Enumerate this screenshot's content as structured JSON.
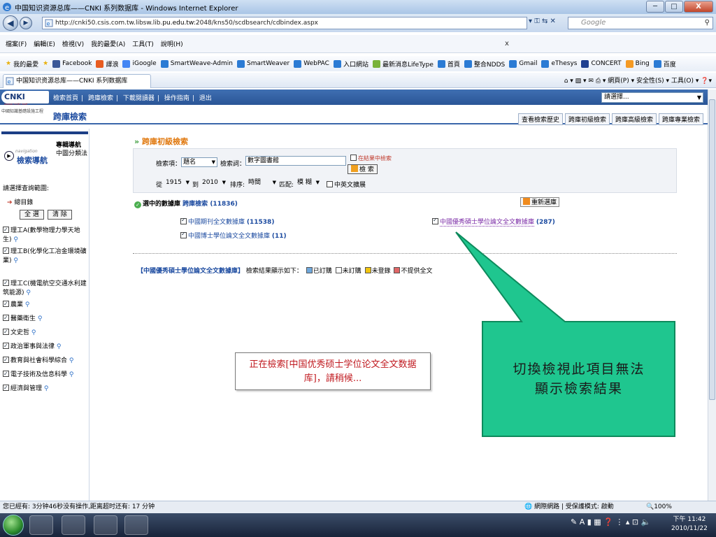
{
  "window": {
    "title": "中国知识资源总库——CNKI 系列数据库 - Windows Internet Explorer",
    "min": "─",
    "max": "□",
    "close": "X"
  },
  "address": {
    "url_pre": "http://cnki50.csis.com.tw.libsw.lib.",
    "url_host": "pu.edu.tw",
    "url_post": ":2048/kns50/scdbsearch/cdbindex.aspx",
    "tools": "▾  ⚿  ⇆  ✕",
    "search_placeholder": "Google"
  },
  "menu": {
    "items": [
      "檔案(F)",
      "編輯(E)",
      "檢視(V)",
      "我的最愛(A)",
      "工具(T)",
      "說明(H)"
    ],
    "close_x": "x"
  },
  "favorites": {
    "label": "我的最愛",
    "items": [
      {
        "label": "Facebook",
        "color": "#3b5998"
      },
      {
        "label": "譯浪",
        "color": "#e85c20"
      },
      {
        "label": "iGoogle",
        "color": "#4285f4"
      },
      {
        "label": "SmartWeave-Admin",
        "color": "#2b7bd4"
      },
      {
        "label": "SmartWeaver",
        "color": "#2b7bd4"
      },
      {
        "label": "WebPAC",
        "color": "#2b7bd4"
      },
      {
        "label": "入口網站",
        "color": "#2b7bd4"
      },
      {
        "label": "最新消息LifeType",
        "color": "#79b23a"
      },
      {
        "label": "首頁",
        "color": "#2b7bd4"
      },
      {
        "label": "整合NDDS",
        "color": "#2b7bd4"
      },
      {
        "label": "Gmail",
        "color": "#2b7bd4"
      },
      {
        "label": "eThesys",
        "color": "#2b7bd4"
      },
      {
        "label": "CONCERT",
        "color": "#1f3f8f"
      },
      {
        "label": "Bing",
        "color": "#f59a23"
      },
      {
        "label": "百度",
        "color": "#2b7bd4"
      }
    ]
  },
  "tab": {
    "label": "中国知识资源总库——CNKI 系列数据库",
    "commands": "⌂ ▾  ▧ ▾  ✉  ⎙ ▾  網頁(P) ▾  安全性(S) ▾  工具(O) ▾  ❓▾"
  },
  "cnki": {
    "logo": "CNKI",
    "logo_sub": "www.cnki.net",
    "nav": [
      "檢索首頁",
      "|",
      "跨庫檢索",
      "|",
      "下載閱讀器",
      "|",
      "操作指南",
      "|",
      "退出"
    ],
    "select_label": "請選擇...",
    "org": "中國知識基礎設施工程",
    "section_title": "跨庫檢索",
    "top_tabs": [
      "查看檢索歷史",
      "跨庫初級檢索",
      "跨庫高級檢索",
      "跨庫專業檢索"
    ]
  },
  "leftnav": {
    "nav_small": "navigation",
    "nav_main": "檢索導航",
    "right1": "專輯導航",
    "right2": "中圖分類法",
    "scope_label": "請選擇查詢範圍:",
    "total_label": "總目錄",
    "select_all": "全 選",
    "clear": "清 除",
    "categories": [
      "理工A(數學物理力學天地生)",
      "理工B(化學化工冶金環境礦業)",
      "理工C(機電航空交通水利建筑能源)",
      "農業",
      "醫藥衛生",
      "文史哲",
      "政治軍事與法律",
      "教育與社會科學綜合",
      "電子技術及信息科學",
      "經濟與管理"
    ]
  },
  "search": {
    "title": "跨庫初級檢索",
    "field_label": "檢索項：",
    "field_value": "題名",
    "term_label": "檢索詞：",
    "term_value": "數字圖書館",
    "in_result": "在結果中檢索",
    "search_btn": "檢 索",
    "from_label": "從",
    "from_year": "1915",
    "to_label": "到",
    "to_year": "2010",
    "sort_label": "排序:",
    "sort_value": "時間",
    "match_label": "匹配:",
    "match_value": "模 糊",
    "expand_label": "中英文擴展"
  },
  "databases": {
    "selected_label": "選中的數據庫",
    "cross_label": "跨庫檢索",
    "total": "(11836)",
    "reselect": "重新選庫",
    "items": [
      {
        "name": "中國期刊全文數據庫",
        "count": "(11538)"
      },
      {
        "name": "中國博士學位論文全文數據庫",
        "count": "(11)"
      },
      {
        "name": "中國優秀碩士學位論文全文數據庫",
        "count": "(287)"
      }
    ]
  },
  "result": {
    "db": "【中國優秀碩士學位論文全文數據庫】",
    "text": "檢索結果顯示如下：",
    "legend": [
      "已訂購",
      "未訂購",
      "未登錄",
      "不提供全文"
    ]
  },
  "loading": {
    "line1": "正在檢索[中国优秀硕士学位论文全文数据",
    "line2": "库]，請稍候..."
  },
  "callout": {
    "line1": "切換檢視此項目無法",
    "line2": "顯示檢索結果",
    "fill": "#1fc68f",
    "stroke": "#0d8a5c"
  },
  "status": {
    "left": "您已經有: 3分钟46秒没有操作,距离超时还有: 17 分钟",
    "zone": "網際網路 | 受保護模式: 啟動",
    "zoom": "🔍100%"
  },
  "taskbar": {
    "tray": "✎ A ▮ ▦ ❓ ⋮ ▴ ⊡ 🔈",
    "time": "下午 11:42",
    "date": "2010/11/22"
  }
}
